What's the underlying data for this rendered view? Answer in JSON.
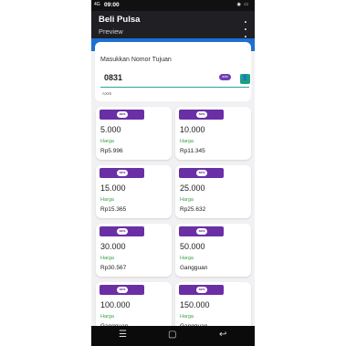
{
  "status_bar": {
    "signal": "4G",
    "time": "09:00",
    "right_icons": "◉ ▭"
  },
  "app_bar": {
    "title": "Beli Pulsa",
    "subtitle": "Preview"
  },
  "input": {
    "label": "Masukkan Nomor Tujuan",
    "value": "0831",
    "operator": "AXIS",
    "badge": "axis"
  },
  "price_label": "Harga",
  "cards": [
    {
      "logo": "axis",
      "nominal": "5.000",
      "price": "Rp5.996"
    },
    {
      "logo": "axis",
      "nominal": "10.000",
      "price": "Rp11.345"
    },
    {
      "logo": "axis",
      "nominal": "15.000",
      "price": "Rp15.365"
    },
    {
      "logo": "axis",
      "nominal": "25.000",
      "price": "Rp25.632"
    },
    {
      "logo": "axis",
      "nominal": "30.000",
      "price": "Rp30.567"
    },
    {
      "logo": "axis",
      "nominal": "50.000",
      "price": "Gangguan"
    },
    {
      "logo": "axis",
      "nominal": "100.000",
      "price": "Gangguan"
    },
    {
      "logo": "axis",
      "nominal": "150.000",
      "price": "Gangguan"
    }
  ],
  "colors": {
    "header": "#1f1f24",
    "accent": "#1d6fd1",
    "operator_purple": "#6a2fa5",
    "price_label_green": "#3aa34a"
  }
}
